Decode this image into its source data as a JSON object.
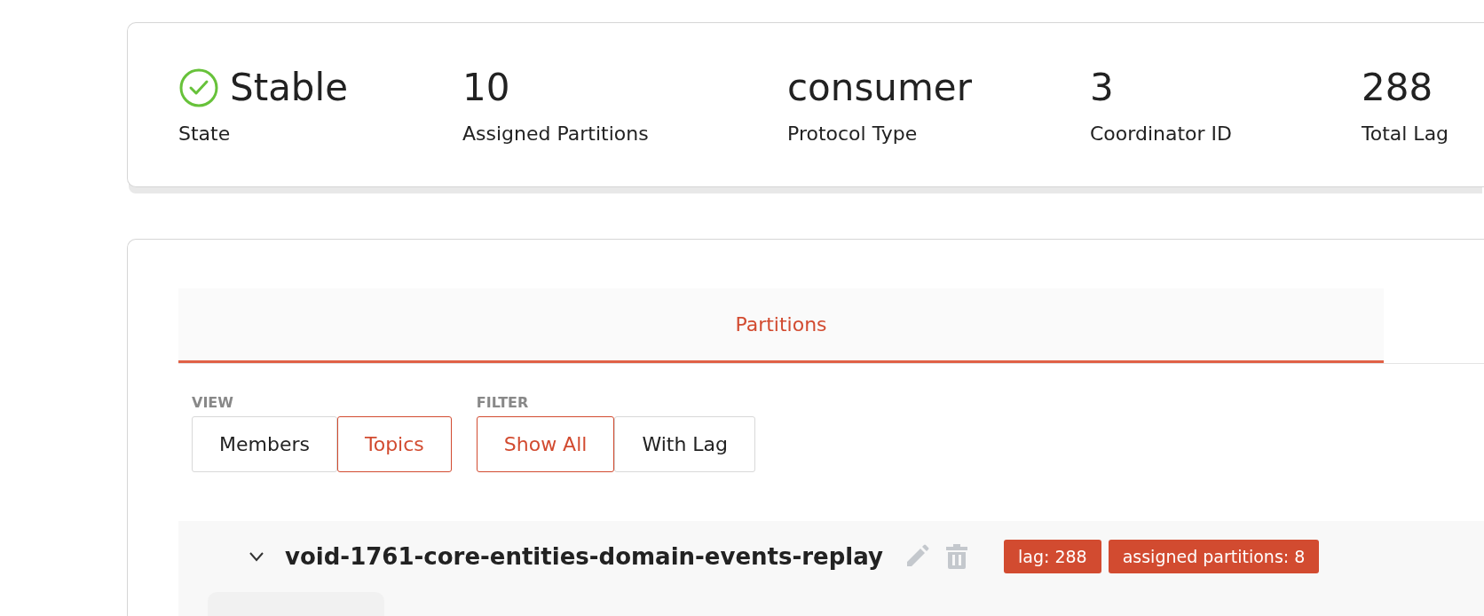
{
  "summary": [
    {
      "kind": "state",
      "value": "Stable",
      "label": "State"
    },
    {
      "kind": "plain",
      "value": "10",
      "label": "Assigned Partitions"
    },
    {
      "kind": "plain",
      "value": "consumer",
      "label": "Protocol Type"
    },
    {
      "kind": "plain",
      "value": "3",
      "label": "Coordinator ID"
    },
    {
      "kind": "plain",
      "value": "288",
      "label": "Total Lag"
    }
  ],
  "tabs": [
    {
      "label": "Partitions",
      "selected": true
    }
  ],
  "view": {
    "label": "VIEW",
    "options": [
      {
        "label": "Members",
        "selected": false
      },
      {
        "label": "Topics",
        "selected": true
      }
    ]
  },
  "filter": {
    "label": "FILTER",
    "options": [
      {
        "label": "Show All",
        "selected": true
      },
      {
        "label": "With Lag",
        "selected": false
      }
    ]
  },
  "topic": {
    "name": "void-1761-core-entities-domain-events-replay",
    "expanded": true,
    "badges": [
      "lag: 288",
      "assigned partitions: 8"
    ]
  }
}
